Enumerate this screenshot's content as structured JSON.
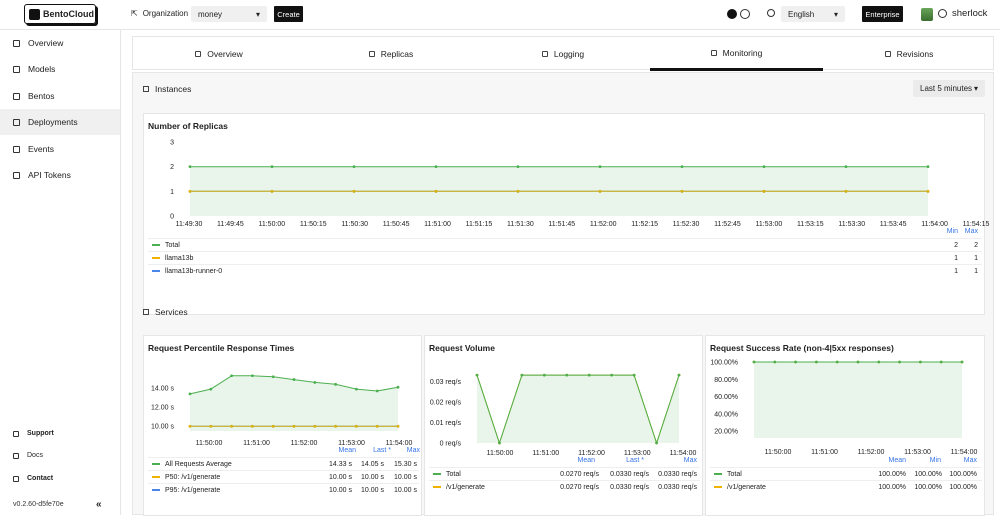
{
  "header": {
    "logo_text": "BentoCloud",
    "organization_label": "Organization",
    "organization_value": "money",
    "create_label": "Create",
    "language_value": "English",
    "enterprise_label": "Enterprise",
    "username": "sherlock"
  },
  "sidebar": {
    "items": [
      {
        "label": "Overview",
        "icon": "dashboard-icon"
      },
      {
        "label": "Models",
        "icon": "cube-icon"
      },
      {
        "label": "Bentos",
        "icon": "box-icon"
      },
      {
        "label": "Deployments",
        "icon": "rocket-icon",
        "active": true
      },
      {
        "label": "Events",
        "icon": "bolt-icon"
      },
      {
        "label": "API Tokens",
        "icon": "key-icon"
      }
    ],
    "bottom": {
      "support": "Support",
      "docs": "Docs",
      "contact": "Contact"
    },
    "version": "v0.2.60-d5fe70e"
  },
  "tabs": [
    {
      "label": "Overview"
    },
    {
      "label": "Replicas"
    },
    {
      "label": "Logging"
    },
    {
      "label": "Monitoring",
      "active": true
    },
    {
      "label": "Revisions"
    }
  ],
  "instances": {
    "title": "Instances",
    "time_range": "Last 5 minutes",
    "replicas_card": {
      "title": "Number of Replicas",
      "legend_headers": [
        "Min",
        "Max"
      ],
      "legend": [
        {
          "name": "Total",
          "color": "#4caf50",
          "min": "2",
          "max": "2"
        },
        {
          "name": "llama13b",
          "color": "#f0b400",
          "min": "1",
          "max": "1"
        },
        {
          "name": "llama13b-runner-0",
          "color": "#4a86e8",
          "min": "1",
          "max": "1"
        }
      ]
    }
  },
  "services": {
    "title": "Services",
    "response_card": {
      "title": "Request Percentile Response Times",
      "legend_headers": [
        "Mean",
        "Last *",
        "Max"
      ],
      "legend": [
        {
          "name": "All Requests Average",
          "color": "#4caf50",
          "vals": [
            "14.33 s",
            "14.05 s",
            "15.30 s"
          ]
        },
        {
          "name": "P50: /v1/generate",
          "color": "#f0b400",
          "vals": [
            "10.00 s",
            "10.00 s",
            "10.00 s"
          ]
        },
        {
          "name": "P95: /v1/generate",
          "color": "#4a86e8",
          "vals": [
            "10.00 s",
            "10.00 s",
            "10.00 s"
          ]
        }
      ]
    },
    "volume_card": {
      "title": "Request Volume",
      "legend_headers": [
        "Mean",
        "Last *",
        "Max"
      ],
      "legend": [
        {
          "name": "Total",
          "color": "#4caf50",
          "vals": [
            "0.0270 req/s",
            "0.0330 req/s",
            "0.0330 req/s"
          ]
        },
        {
          "name": "/v1/generate",
          "color": "#f0b400",
          "vals": [
            "0.0270 req/s",
            "0.0330 req/s",
            "0.0330 req/s"
          ]
        }
      ]
    },
    "success_card": {
      "title": "Request Success Rate (non-4|5xx responses)",
      "legend_headers": [
        "Mean",
        "Min",
        "Max"
      ],
      "legend": [
        {
          "name": "Total",
          "color": "#4caf50",
          "vals": [
            "100.00%",
            "100.00%",
            "100.00%"
          ]
        },
        {
          "name": "/v1/generate",
          "color": "#f0b400",
          "vals": [
            "100.00%",
            "100.00%",
            "100.00%"
          ]
        }
      ]
    }
  },
  "chart_data": [
    {
      "type": "line",
      "title": "Number of Replicas",
      "x": [
        "11:49:30",
        "11:49:45",
        "11:50:00",
        "11:50:15",
        "11:50:30",
        "11:50:45",
        "11:51:00",
        "11:51:15",
        "11:51:30",
        "11:51:45",
        "11:52:00",
        "11:52:15",
        "11:52:30",
        "11:52:45",
        "11:53:00",
        "11:53:15",
        "11:53:30",
        "11:53:45",
        "11:54:00",
        "11:54:15"
      ],
      "yticks": [
        "0",
        "1",
        "2",
        "3"
      ],
      "ylim": [
        0,
        3
      ],
      "series": [
        {
          "name": "Total",
          "color": "#4caf50",
          "values": [
            2,
            2,
            2,
            2,
            2,
            2,
            2,
            2,
            2,
            2
          ]
        },
        {
          "name": "llama13b",
          "color": "#f0b400",
          "values": [
            1,
            1,
            1,
            1,
            1,
            1,
            1,
            1,
            1,
            1
          ]
        },
        {
          "name": "llama13b-runner-0",
          "color": "#4a86e8",
          "values": [
            1,
            1,
            1,
            1,
            1,
            1,
            1,
            1,
            1,
            1
          ]
        }
      ]
    },
    {
      "type": "line",
      "title": "Request Percentile Response Times",
      "x": [
        "11:50:00",
        "11:51:00",
        "11:52:00",
        "11:53:00",
        "11:54:00"
      ],
      "yticks": [
        "10.00 s",
        "12.00 s",
        "14.00 s"
      ],
      "ylim": [
        9.5,
        15.8
      ],
      "series": [
        {
          "name": "All Requests Average",
          "color": "#4caf50",
          "values": [
            13.4,
            13.9,
            15.3,
            15.3,
            15.2,
            14.9,
            14.6,
            14.4,
            13.9,
            13.7,
            14.1
          ]
        },
        {
          "name": "P50: /v1/generate",
          "color": "#f0b400",
          "values": [
            10,
            10,
            10,
            10,
            10,
            10,
            10,
            10,
            10,
            10,
            10
          ]
        },
        {
          "name": "P95: /v1/generate",
          "color": "#4a86e8",
          "values": [
            10,
            10,
            10,
            10,
            10,
            10,
            10,
            10,
            10,
            10,
            10
          ]
        }
      ]
    },
    {
      "type": "line",
      "title": "Request Volume",
      "x": [
        "11:50:00",
        "11:51:00",
        "11:52:00",
        "11:53:00",
        "11:54:00"
      ],
      "yticks": [
        "0 req/s",
        "0.01 req/s",
        "0.02 req/s",
        "0.03 req/s"
      ],
      "ylim": [
        0,
        0.035
      ],
      "series": [
        {
          "name": "Total",
          "color": "#4caf50",
          "values": [
            0.033,
            0.0,
            0.033,
            0.033,
            0.033,
            0.033,
            0.033,
            0.033,
            0.0,
            0.033
          ]
        },
        {
          "name": "/v1/generate",
          "color": "#f0b400",
          "values": [
            0.033,
            0.0,
            0.033,
            0.033,
            0.033,
            0.033,
            0.033,
            0.033,
            0.0,
            0.033
          ]
        }
      ]
    },
    {
      "type": "line",
      "title": "Request Success Rate (non-4|5xx responses)",
      "x": [
        "11:50:00",
        "11:51:00",
        "11:52:00",
        "11:53:00",
        "11:54:00"
      ],
      "yticks": [
        "20.00%",
        "40.00%",
        "60.00%",
        "80.00%",
        "100.00%"
      ],
      "ylim": [
        12,
        100
      ],
      "series": [
        {
          "name": "Total",
          "color": "#4caf50",
          "values": [
            100,
            100,
            100,
            100,
            100,
            100,
            100,
            100,
            100,
            100,
            100
          ]
        },
        {
          "name": "/v1/generate",
          "color": "#f0b400",
          "values": [
            100,
            100,
            100,
            100,
            100,
            100,
            100,
            100,
            100,
            100,
            100
          ]
        }
      ]
    }
  ]
}
